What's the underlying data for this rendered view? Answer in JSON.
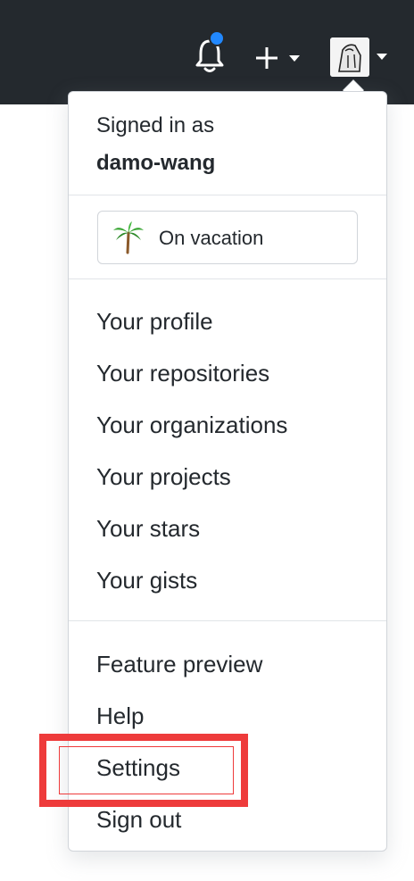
{
  "header": {
    "notifications_icon": "bell-icon",
    "create_icon": "plus-icon",
    "avatar_icon": "user-avatar"
  },
  "dropdown": {
    "signed_in_label": "Signed in as",
    "username": "damo-wang",
    "status": {
      "emoji_icon": "palm-tree-icon",
      "text": "On vacation"
    },
    "primary_items": [
      {
        "label": "Your profile"
      },
      {
        "label": "Your repositories"
      },
      {
        "label": "Your organizations"
      },
      {
        "label": "Your projects"
      },
      {
        "label": "Your stars"
      },
      {
        "label": "Your gists"
      }
    ],
    "secondary_items": [
      {
        "label": "Feature preview"
      },
      {
        "label": "Help"
      },
      {
        "label": "Settings"
      },
      {
        "label": "Sign out"
      }
    ]
  },
  "colors": {
    "header_bg": "#24292e",
    "notification_dot": "#2188ff",
    "highlight": "#ee3b3b",
    "text": "#24292e",
    "border": "#d1d5da"
  }
}
